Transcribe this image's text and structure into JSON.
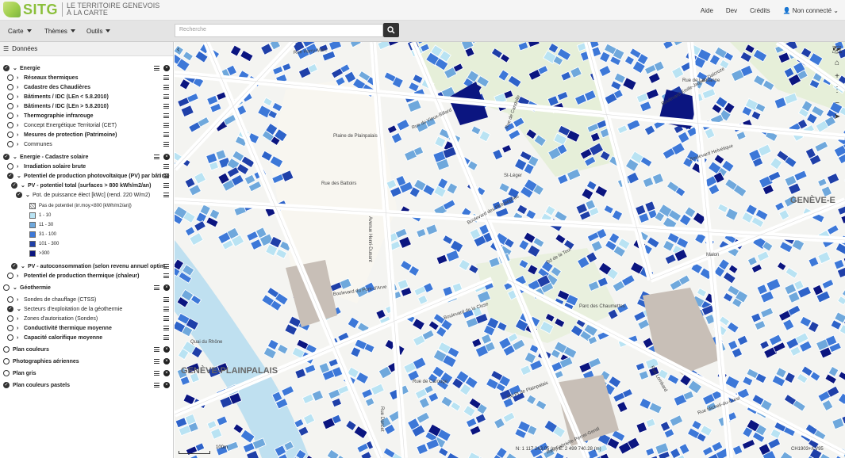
{
  "header": {
    "logo_text": "SITG",
    "logo_subtitle": "LE TERRITOIRE GENEVOIS À LA CARTE",
    "links": [
      "Aide",
      "Dev",
      "Crédits"
    ],
    "user": "Non connecté"
  },
  "menubar": {
    "menus": [
      "Carte",
      "Thèmes",
      "Outils"
    ],
    "search_placeholder": "Recherche"
  },
  "panel": {
    "title": "Données",
    "layers": [
      {
        "label": "Energie",
        "checked": true,
        "level": 0,
        "bold": true,
        "close": true
      },
      {
        "label": "Réseaux thermiques",
        "level": 1,
        "bold": true
      },
      {
        "label": "Cadastre des Chaudières",
        "level": 1,
        "bold": true
      },
      {
        "label": "Bâtiments / IDC (LEn < 5.8.2010)",
        "level": 1,
        "bold": true
      },
      {
        "label": "Bâtiments / IDC (LEn > 5.8.2010)",
        "level": 1,
        "bold": true
      },
      {
        "label": "Thermographie infrarouge",
        "level": 1,
        "bold": true
      },
      {
        "label": "Concept Energétique Territorial (CET)",
        "level": 1,
        "bold": false
      },
      {
        "label": "Mesures de protection (Patrimoine)",
        "level": 1,
        "bold": true
      },
      {
        "label": "Communes",
        "level": 1,
        "bold": false
      },
      {
        "label": "Energie - Cadastre solaire",
        "checked": true,
        "level": 0,
        "bold": true,
        "close": true
      },
      {
        "label": "Irradiation solaire brute",
        "level": 1,
        "bold": true
      },
      {
        "label": "Potentiel de production photovoltaïque (PV) par bâtime",
        "checked": true,
        "level": 1,
        "bold": true
      },
      {
        "label": "PV - potentiel total (surfaces > 800 kWh/m2/an)",
        "checked": true,
        "level": 2,
        "bold": true
      },
      {
        "label": "Pot. de puissance élect [kWc] (rend. 220 W/m2)",
        "checked": true,
        "level": 3,
        "bold": false
      }
    ],
    "legend": [
      {
        "label": "Pas de potentiel (irr.moy.<800 [kWh/m2/an])",
        "color": "hatch"
      },
      {
        "label": "1 - 10",
        "color": "#b9e3f3"
      },
      {
        "label": "11 - 30",
        "color": "#6fa8dc"
      },
      {
        "label": "31 - 100",
        "color": "#3d78d8"
      },
      {
        "label": "101 - 300",
        "color": "#1f3fa8"
      },
      {
        "label": ">300",
        "color": "#0b1580"
      }
    ],
    "layers2": [
      {
        "label": "PV - autoconsommation (selon revenu annuel optim.",
        "checked": true,
        "level": 2,
        "bold": true
      },
      {
        "label": "Potentiel de production thermique (chaleur)",
        "level": 1,
        "bold": true
      },
      {
        "label": "Géothermie",
        "level": 0,
        "bold": true,
        "close": true
      },
      {
        "label": "Sondes de chauffage (CTSS)",
        "level": 1,
        "bold": false
      },
      {
        "label": "Secteurs d'exploitation de la géothermie",
        "checked": true,
        "level": 1,
        "bold": false
      },
      {
        "label": "Zones d'autorisation (Sondes)",
        "level": 1,
        "bold": false
      },
      {
        "label": "Conductivité thermique moyenne",
        "level": 1,
        "bold": true
      },
      {
        "label": "Capacité calorifique moyenne",
        "level": 1,
        "bold": true
      },
      {
        "label": "Plan couleurs",
        "level": -1,
        "bold": true,
        "close": true
      },
      {
        "label": "Photographies aériennes",
        "level": -1,
        "bold": true,
        "close": true
      },
      {
        "label": "Plan gris",
        "level": -1,
        "bold": true,
        "close": true
      },
      {
        "label": "Plan couleurs pastels",
        "checked": true,
        "level": -1,
        "bold": true,
        "close": true
      }
    ]
  },
  "map": {
    "labels": [
      "Plaine de Plainpalais",
      "Boulevard des Philosophes",
      "Boulevard du Pont-d'Arve",
      "Avenue Henri-Dunant",
      "Parc des Chaumettes",
      "Rue de Carouge",
      "Boulevard Helvétique",
      "Quai du Rhône",
      "Rue de Lausanne",
      "Malon",
      "Rue Lombard",
      "Bd de la Tour",
      "Rue Harry-Marc",
      "Rue de Candolle",
      "Boulevard Emile-Jaques-Dalcroze",
      "St-Léger",
      "Rue Dancet",
      "Rue du Vieux-Billard",
      "Rue des Battoirs",
      "Rd-Pt de Plainpalais",
      "Boulevard de la Cluse",
      "Rue Micheli-du-Crest",
      "Rue Gabrielle-Perret-Gentil"
    ],
    "quartiers": [
      "GENÈVE-PLAINPALAIS",
      "GENÈVE-E"
    ],
    "scale": "100m",
    "coords": "N: 1 117 243.05 (m)   E: 2 499 740.28 (m)",
    "crs": "CH1903+/LV95"
  },
  "colors": {
    "accent": "#8bbf3b",
    "building_light": "#b9e3f3",
    "building_mid": "#3d78d8",
    "building_dark": "#0b1580"
  }
}
